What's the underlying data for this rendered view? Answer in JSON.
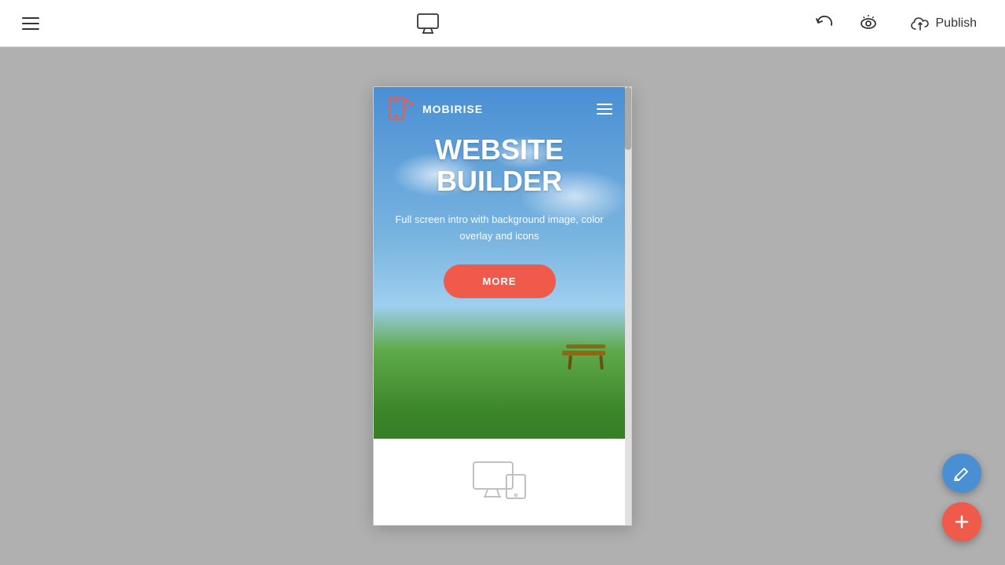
{
  "toolbar": {
    "publish_label": "Publish"
  },
  "preview": {
    "nav": {
      "logo_text": "MOBIRISE",
      "menu_aria": "Navigation menu"
    },
    "hero": {
      "title_line1": "WEBSITE",
      "title_line2": "BUILDER",
      "subtitle": "Full screen intro with background image, color overlay and icons",
      "cta_label": "MORE"
    }
  },
  "icons": {
    "hamburger": "☰",
    "undo": "↩",
    "eye": "👁",
    "upload_cloud": "☁",
    "pencil": "✏",
    "plus": "+"
  }
}
